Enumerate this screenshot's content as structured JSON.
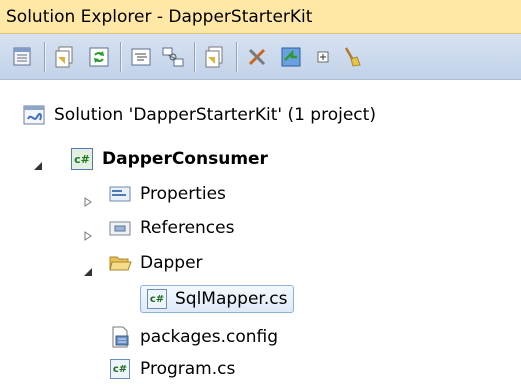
{
  "panel": {
    "title": "Solution Explorer - DapperStarterKit"
  },
  "toolbar": {
    "buttons": [
      {
        "name": "properties-icon"
      },
      {
        "name": "show-all-files-icon"
      },
      {
        "name": "refresh-icon"
      },
      {
        "name": "view-code-icon"
      },
      {
        "name": "view-class-diagram-icon"
      },
      {
        "name": "add-item-icon"
      },
      {
        "name": "tools-icon"
      },
      {
        "name": "sync-icon"
      },
      {
        "name": "collapse-all-icon"
      },
      {
        "name": "clean-icon"
      }
    ]
  },
  "tree": {
    "solution": {
      "label": "Solution 'DapperStarterKit' (1 project)",
      "icon": "solution-icon"
    },
    "project": {
      "label": "DapperConsumer",
      "icon": "csharp-project-icon",
      "expanded": true
    },
    "items": [
      {
        "label": "Properties",
        "icon": "properties-folder-icon",
        "expander": "collapsed"
      },
      {
        "label": "References",
        "icon": "references-folder-icon",
        "expander": "collapsed"
      },
      {
        "label": "Dapper",
        "icon": "open-folder-icon",
        "expander": "expanded"
      },
      {
        "label": "SqlMapper.cs",
        "icon": "csharp-file-icon",
        "selected": true
      },
      {
        "label": "packages.config",
        "icon": "config-file-icon"
      },
      {
        "label": "Program.cs",
        "icon": "csharp-file-icon"
      }
    ],
    "file_badge": "c#"
  },
  "colors": {
    "title_bar": "#ffe8a6",
    "toolbar": "#c9d7ec",
    "selection_border": "#8fb2dd"
  }
}
